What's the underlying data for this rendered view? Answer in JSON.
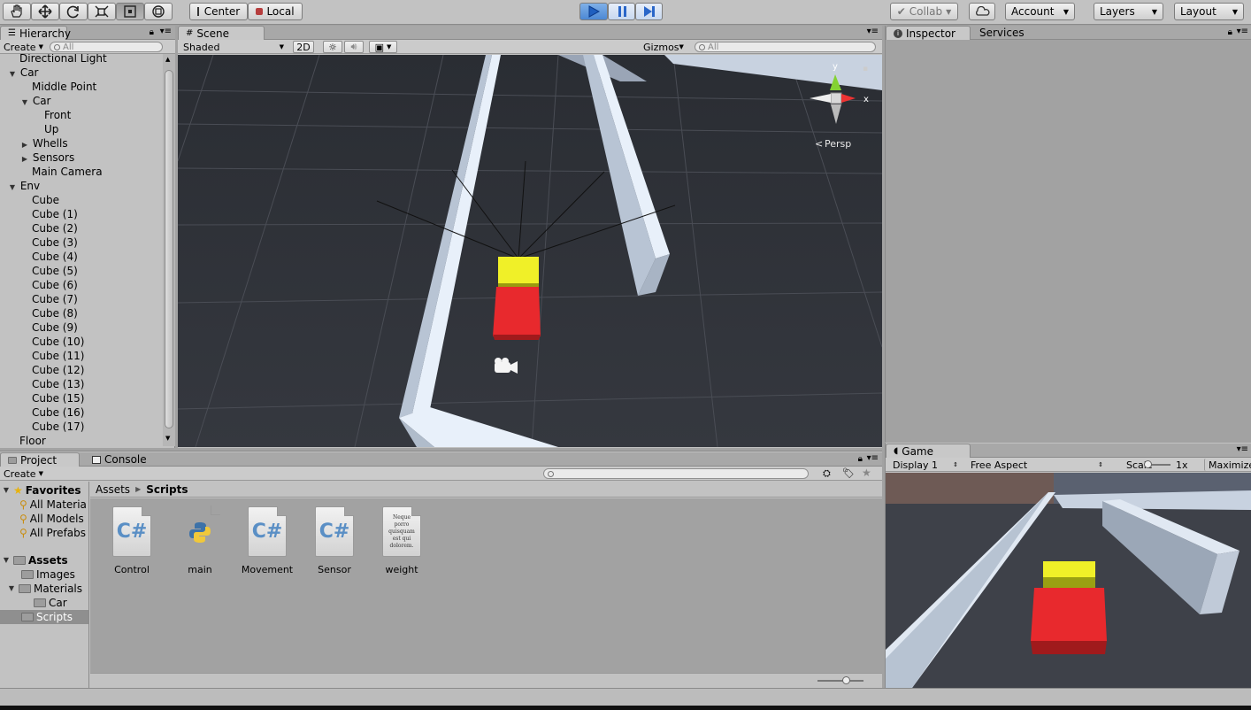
{
  "toolbar": {
    "pivot_mode": "Center",
    "pivot_rotation": "Local",
    "collab": "Collab",
    "account": "Account",
    "layers": "Layers",
    "layout": "Layout"
  },
  "hierarchy": {
    "tab": "Hierarchy",
    "create": "Create",
    "search_placeholder": "All",
    "items": [
      {
        "label": "Directional Light"
      },
      {
        "label": "Car"
      },
      {
        "label": "Middle Point"
      },
      {
        "label": "Car"
      },
      {
        "label": "Front"
      },
      {
        "label": "Up"
      },
      {
        "label": "Whells"
      },
      {
        "label": "Sensors"
      },
      {
        "label": "Main Camera"
      },
      {
        "label": "Env"
      },
      {
        "label": "Cube"
      },
      {
        "label": "Cube (1)"
      },
      {
        "label": "Cube (2)"
      },
      {
        "label": "Cube (3)"
      },
      {
        "label": "Cube (4)"
      },
      {
        "label": "Cube (5)"
      },
      {
        "label": "Cube (6)"
      },
      {
        "label": "Cube (7)"
      },
      {
        "label": "Cube (8)"
      },
      {
        "label": "Cube (9)"
      },
      {
        "label": "Cube (10)"
      },
      {
        "label": "Cube (11)"
      },
      {
        "label": "Cube (12)"
      },
      {
        "label": "Cube (13)"
      },
      {
        "label": "Cube (15)"
      },
      {
        "label": "Cube (16)"
      },
      {
        "label": "Cube (17)"
      },
      {
        "label": "Floor"
      }
    ]
  },
  "scene": {
    "tab": "Scene",
    "draw_mode": "Shaded",
    "mode_2d": "2D",
    "gizmos": "Gizmos",
    "search_placeholder": "All",
    "gizmo_y": "y",
    "gizmo_x": "x",
    "projection": "Persp"
  },
  "inspector": {
    "tab": "Inspector",
    "services_tab": "Services"
  },
  "project": {
    "tab": "Project",
    "console_tab": "Console",
    "create": "Create",
    "breadcrumb_root": "Assets",
    "breadcrumb_current": "Scripts",
    "favorites_label": "Favorites",
    "favorites": [
      "All Materia",
      "All Models",
      "All Prefabs"
    ],
    "assets_label": "Assets",
    "folders": [
      "Images",
      "Materials",
      "Car",
      "Scripts"
    ],
    "assets": [
      {
        "name": "Control",
        "kind": "csharp"
      },
      {
        "name": "main",
        "kind": "python"
      },
      {
        "name": "Movement",
        "kind": "csharp"
      },
      {
        "name": "Sensor",
        "kind": "csharp"
      },
      {
        "name": "weight",
        "kind": "text",
        "preview": "Neque porro quisquam est qui dolorem."
      }
    ]
  },
  "game": {
    "tab": "Game",
    "display": "Display 1",
    "aspect": "Free Aspect",
    "scale_label": "Scale",
    "scale_value": "1x",
    "maximize": "Maximize"
  }
}
